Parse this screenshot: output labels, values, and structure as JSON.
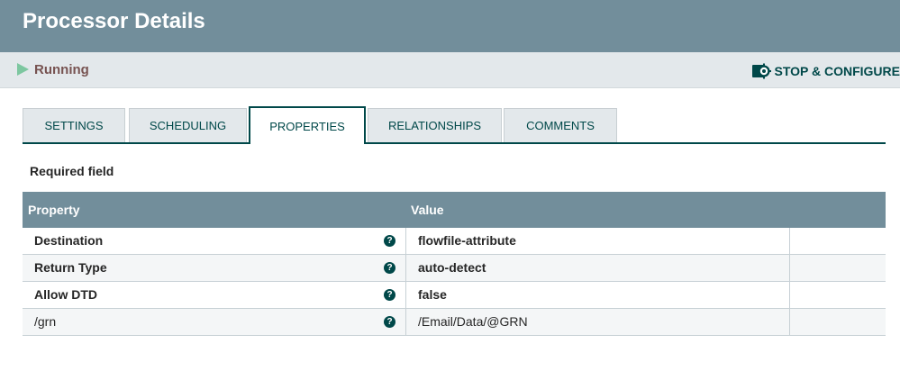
{
  "header": {
    "title": "Processor Details"
  },
  "status": {
    "label": "Running",
    "run_color": "#7dc7a0",
    "label_color": "#775351"
  },
  "actions": {
    "stop_configure_label": "STOP & CONFIGURE"
  },
  "tabs": [
    {
      "label": "SETTINGS",
      "active": false
    },
    {
      "label": "SCHEDULING",
      "active": false
    },
    {
      "label": "PROPERTIES",
      "active": true
    },
    {
      "label": "RELATIONSHIPS",
      "active": false
    },
    {
      "label": "COMMENTS",
      "active": false
    }
  ],
  "properties": {
    "required_label": "Required field",
    "columns": {
      "property": "Property",
      "value": "Value"
    },
    "help_glyph": "?",
    "rows": [
      {
        "name": "Destination",
        "value": "flowfile-attribute",
        "required": true
      },
      {
        "name": "Return Type",
        "value": "auto-detect",
        "required": true
      },
      {
        "name": "Allow DTD",
        "value": "false",
        "required": true
      },
      {
        "name": "/grn",
        "value": "/Email/Data/@GRN",
        "required": false
      }
    ]
  },
  "colors": {
    "header_bg": "#728e9b",
    "accent": "#004849",
    "status_bar_bg": "#e3e8eb"
  }
}
